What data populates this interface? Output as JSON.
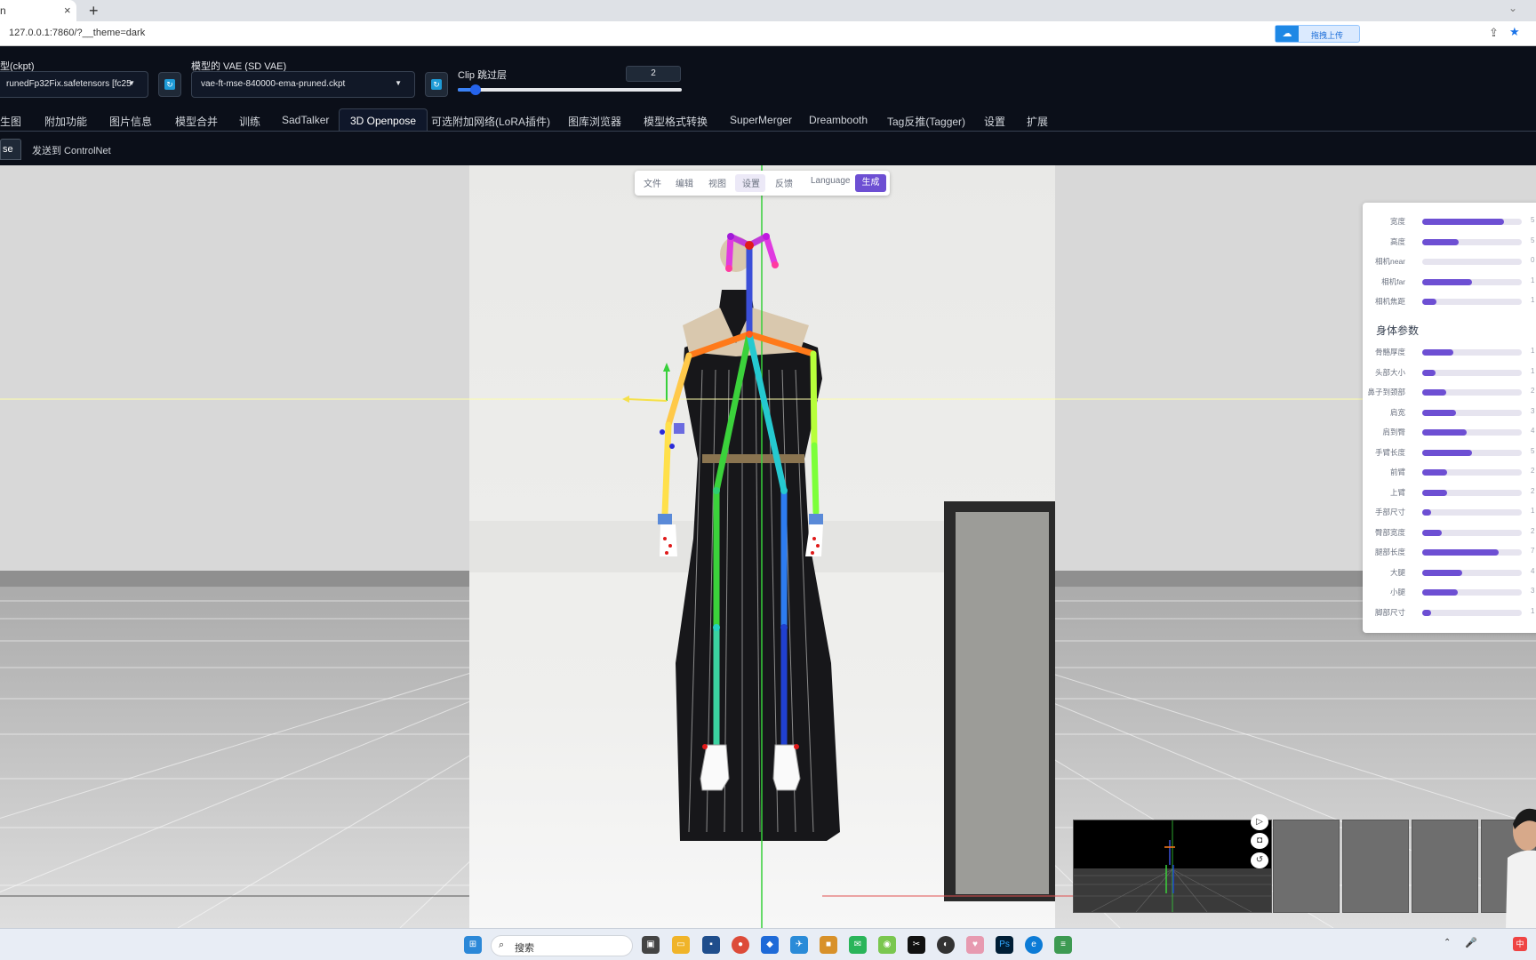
{
  "browser": {
    "tab_title": "n",
    "tab_close": "×",
    "new_tab": "+",
    "url": "127.0.0.1:7860/?__theme=dark",
    "extension_label": "拖拽上传"
  },
  "header": {
    "ckpt_label": "型(ckpt)",
    "ckpt_value": "runedFp32Fix.safetensors [fc25",
    "vae_label": "模型的 VAE (SD VAE)",
    "vae_value": "vae-ft-mse-840000-ema-pruned.ckpt",
    "clip_label": "Clip 跳过层",
    "clip_value": "2",
    "clip_fraction": 0.08
  },
  "tabs": [
    {
      "label": "生图"
    },
    {
      "label": "附加功能"
    },
    {
      "label": "图片信息"
    },
    {
      "label": "模型合并"
    },
    {
      "label": "训练"
    },
    {
      "label": "SadTalker"
    },
    {
      "label": "3D Openpose",
      "active": true
    },
    {
      "label": "可选附加网络(LoRA插件)"
    },
    {
      "label": "图库浏览器"
    },
    {
      "label": "模型格式转换"
    },
    {
      "label": "SuperMerger"
    },
    {
      "label": "Dreambooth"
    },
    {
      "label": "Tag反推(Tagger)"
    },
    {
      "label": "设置"
    },
    {
      "label": "扩展"
    }
  ],
  "subtabs": [
    {
      "label": "se",
      "active": true
    },
    {
      "label": "发送到 ControlNet"
    }
  ],
  "menubar": {
    "items": [
      "文件",
      "编辑",
      "视图",
      "设置",
      "反馈",
      "Language"
    ],
    "generate": "生成"
  },
  "panel": {
    "camera": [
      {
        "label": "宽度",
        "value": 0.82,
        "text": "5"
      },
      {
        "label": "高度",
        "value": 0.37,
        "text": "5"
      },
      {
        "label": "相机near",
        "value": 0.0,
        "text": "0"
      },
      {
        "label": "相机far",
        "value": 0.5,
        "text": "1"
      },
      {
        "label": "相机焦距",
        "value": 0.14,
        "text": "1"
      }
    ],
    "body_title": "身体参数",
    "body": [
      {
        "label": "骨骼厚度",
        "value": 0.31,
        "text": "1"
      },
      {
        "label": "头部大小",
        "value": 0.13,
        "text": "1"
      },
      {
        "label": "鼻子到颈部",
        "value": 0.24,
        "text": "2"
      },
      {
        "label": "肩宽",
        "value": 0.34,
        "text": "3"
      },
      {
        "label": "肩到臀",
        "value": 0.45,
        "text": "4"
      },
      {
        "label": "手臂长度",
        "value": 0.5,
        "text": "5"
      },
      {
        "label": "前臂",
        "value": 0.25,
        "text": "2"
      },
      {
        "label": "上臂",
        "value": 0.25,
        "text": "2"
      },
      {
        "label": "手部尺寸",
        "value": 0.09,
        "text": "1"
      },
      {
        "label": "臀部宽度",
        "value": 0.2,
        "text": "2"
      },
      {
        "label": "腿部长度",
        "value": 0.77,
        "text": "7"
      },
      {
        "label": "大腿",
        "value": 0.4,
        "text": "4"
      },
      {
        "label": "小腿",
        "value": 0.36,
        "text": "3"
      },
      {
        "label": "脚部尺寸",
        "value": 0.09,
        "text": "1"
      }
    ]
  },
  "taskbar": {
    "search_label": "搜索"
  },
  "colors": {
    "accent": "#6d4fd3",
    "app_bg": "#0b0f19",
    "floor": "#c4c4c4"
  }
}
